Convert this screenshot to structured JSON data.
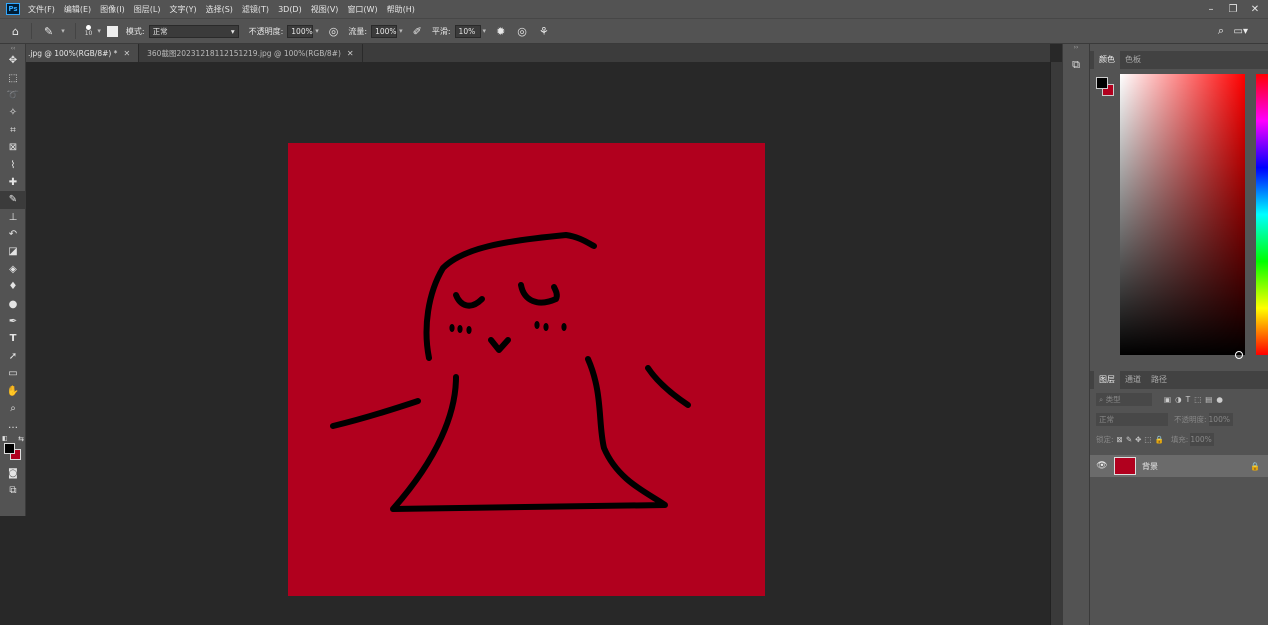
{
  "app": {
    "logo": "Ps"
  },
  "menu": [
    "文件(F)",
    "编辑(E)",
    "图像(I)",
    "图层(L)",
    "文字(Y)",
    "选择(S)",
    "滤镜(T)",
    "3D(D)",
    "视图(V)",
    "窗口(W)",
    "帮助(H)"
  ],
  "options": {
    "brush_size": "10",
    "mode_label": "模式:",
    "mode_value": "正常",
    "opacity_label": "不透明度:",
    "opacity_value": "100%",
    "flow_label": "流量:",
    "flow_value": "100%",
    "smooth_label": "平滑:",
    "smooth_value": "10%"
  },
  "tabs": [
    {
      "label": ".jpg @ 100%(RGB/8#) *",
      "active": true
    },
    {
      "label": "360截图20231218112151219.jpg @ 100%(RGB/8#)",
      "active": false
    }
  ],
  "colors": {
    "foreground": "#000000",
    "background": "#b1001e",
    "canvas": "#b1001e"
  },
  "color_panel": {
    "tabs": [
      "颜色",
      "色板"
    ]
  },
  "layers_panel": {
    "tabs": [
      "图层",
      "通道",
      "路径"
    ],
    "filter_placeholder": "类型",
    "blend_mode": "正常",
    "opacity_label": "不透明度:",
    "opacity_value": "100%",
    "lock_label": "锁定:",
    "fill_label": "填充:",
    "fill_value": "100%",
    "layer_name": "背景"
  }
}
